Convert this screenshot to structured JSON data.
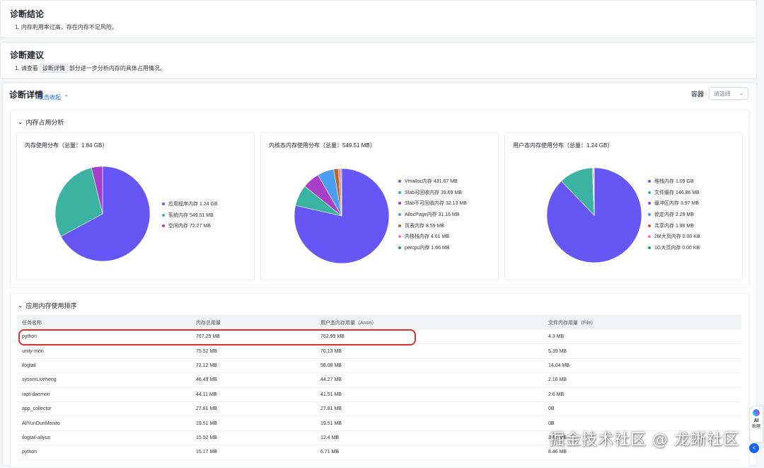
{
  "conclusion": {
    "title": "诊断结论",
    "items": [
      "1. 内存利用率过高，存在内存不足风险。"
    ]
  },
  "advice": {
    "title": "诊断建议",
    "prefix": "1. 请查看",
    "tag": "诊断详情",
    "suffix": "部分进一步分析内存的具体占用情况。"
  },
  "details": {
    "title": "诊断详情",
    "collapse_link": "点击收起",
    "container_label": "容器",
    "container_placeholder": "请选择",
    "memory_section_title": "内存占用分析",
    "ranking_section_title": "应用内存使用排序"
  },
  "charts": [
    {
      "title": "内存使用分布（总量：1.84 GB）",
      "legend": [
        {
          "label": "应用程序内存  1.24 GB",
          "value": 1.24,
          "color": "#6656f5"
        },
        {
          "label": "系统内存  549.51 MB",
          "value": 0.537,
          "color": "#3bb3a3"
        },
        {
          "label": "空闲内存  72.27 MB",
          "value": 0.0706,
          "color": "#a83fc9"
        }
      ]
    },
    {
      "title": "内核态内存使用分布（总量：549.51 MB）",
      "legend": [
        {
          "label": "Vmalloc内存  431.67 MB",
          "value": 431.67,
          "color": "#6656f5"
        },
        {
          "label": "Slab可回收内存  39.69 MB",
          "value": 39.69,
          "color": "#3bb3a3"
        },
        {
          "label": "Slab不可回收内存  32.13 MB",
          "value": 32.13,
          "color": "#a83fc9"
        },
        {
          "label": "AllocPage内存  31.16 MB",
          "value": 31.16,
          "color": "#4a9ff5"
        },
        {
          "label": "页表内存  8.59 MB",
          "value": 8.59,
          "color": "#b5651d"
        },
        {
          "label": "内核栈内存  4.61 MB",
          "value": 4.61,
          "color": "#f07ab0"
        },
        {
          "label": "percpu内存  1.66 MB",
          "value": 1.66,
          "color": "#2e9c5a"
        }
      ]
    },
    {
      "title": "用户态内存使用分布（总量：1.24 GB）",
      "legend": [
        {
          "label": "堆栈内存  1.09 GB",
          "value": 1.09,
          "color": "#6656f5"
        },
        {
          "label": "文件缓存  146.86 MB",
          "value": 0.1434,
          "color": "#3bb3a3"
        },
        {
          "label": "缓冲区内存  3.97 MB",
          "value": 0.00388,
          "color": "#a83fc9"
        },
        {
          "label": "锁定内存  2.29 MB",
          "value": 0.00224,
          "color": "#4a9ff5"
        },
        {
          "label": "共享内存  1.98 MB",
          "value": 0.00193,
          "color": "#b5651d"
        },
        {
          "label": "2M大页内存  0.00 KB",
          "value": 0,
          "color": "#f07ab0"
        },
        {
          "label": "1G大页内存  0.00 KB",
          "value": 0,
          "color": "#2e9c5a"
        }
      ]
    }
  ],
  "table": {
    "columns": [
      "任务名称",
      "内存总用量",
      "用户态内存用量（Anon）",
      "文件内存用量（File）"
    ],
    "rows": [
      [
        "python",
        "767.25 MB",
        "762.95 MB",
        "4.3 MB"
      ],
      [
        "unity-mon",
        "75.52 MB",
        "70.13 MB",
        "5.39 MB"
      ],
      [
        "ilogtail",
        "72.12 MB",
        "58.08 MB",
        "14.04 MB"
      ],
      [
        "sysomLiveheng",
        "46.43 MB",
        "44.27 MB",
        "2.16 MB"
      ],
      [
        "rapt-daemon",
        "44.11 MB",
        "41.51 MB",
        "2.6 MB"
      ],
      [
        "app_collector",
        "27.81 MB",
        "27.81 MB",
        "0B"
      ],
      [
        "AliYunDunMonito",
        "19.51 MB",
        "19.51 MB",
        "0B"
      ],
      [
        "ilogtail-aliyun",
        "15.52 MB",
        "12.4 MB",
        "3.12 MB"
      ],
      [
        "python",
        "15.17 MB",
        "6.71 MB",
        "8.46 MB"
      ]
    ]
  },
  "watermark": "掘金技术社区 @ 龙蜥社区",
  "assistant": {
    "label_top": "AI",
    "label_bottom": "助理",
    "collapse_icon": "<"
  }
}
